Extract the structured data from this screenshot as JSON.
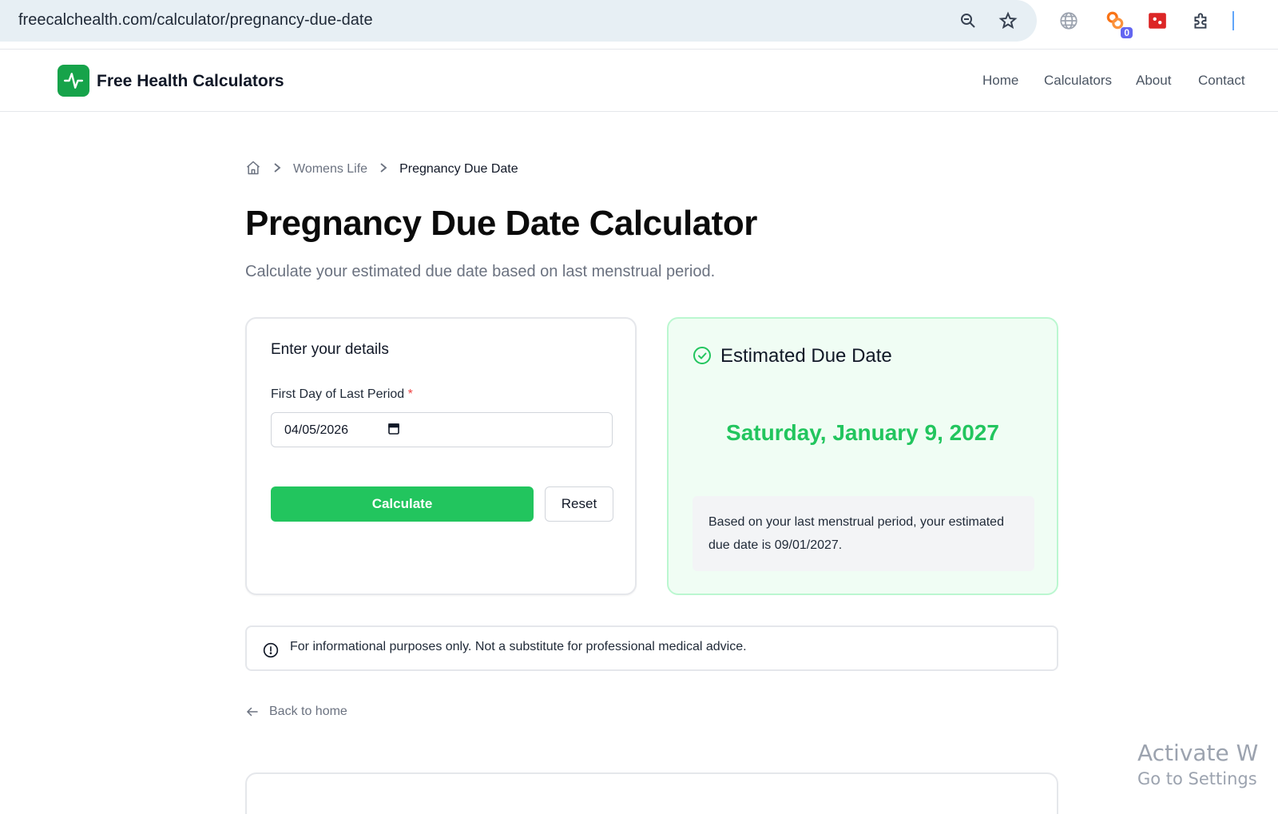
{
  "browser": {
    "url": "freecalchealth.com/calculator/pregnancy-due-date",
    "extension_badge": "0"
  },
  "site": {
    "name": "Free Health Calculators",
    "nav": [
      "Home",
      "Calculators",
      "About",
      "Contact"
    ]
  },
  "breadcrumb": {
    "parent": "Womens Life",
    "current": "Pregnancy Due Date"
  },
  "page": {
    "title": "Pregnancy Due Date Calculator",
    "subtitle": "Calculate your estimated due date based on last menstrual period."
  },
  "form": {
    "heading": "Enter your details",
    "field_label": "First Day of Last Period",
    "required_mark": "*",
    "date_value": "04/05/2026",
    "calculate_label": "Calculate",
    "reset_label": "Reset"
  },
  "result": {
    "heading": "Estimated Due Date",
    "due_date": "Saturday, January 9, 2027",
    "note": "Based on your last menstrual period, your estimated due date is 09/01/2027."
  },
  "disclaimer": "For informational purposes only. Not a substitute for professional medical advice.",
  "back_link": "Back to home",
  "watermark": {
    "line1": "Activate W",
    "line2": "Go to Settings"
  },
  "colors": {
    "brand_green": "#16a34a",
    "accent_green": "#22c55e",
    "result_bg": "#f0fdf4"
  }
}
